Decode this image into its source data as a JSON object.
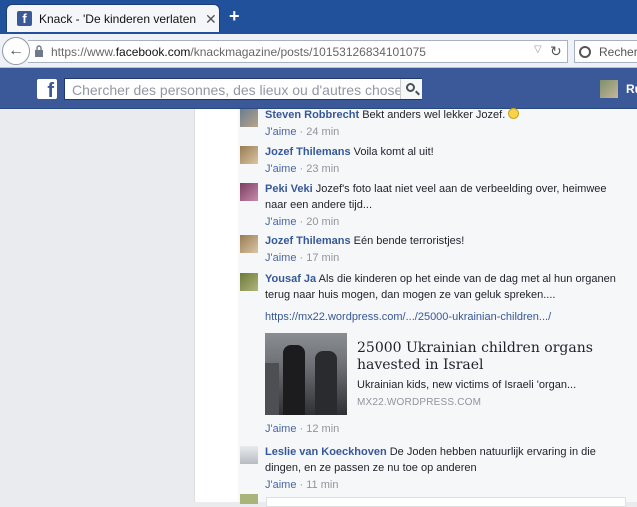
{
  "browser": {
    "tab_title": "Knack - 'De kinderen verlaten ...",
    "url_prefix": "https://www.",
    "url_domain": "facebook.com",
    "url_path": "/knackmagazine/posts/10153126834101075",
    "search_placeholder": "Recherc"
  },
  "facebook": {
    "search_placeholder": "Chercher des personnes, des lieux ou d'autres choses",
    "user_short": "Ru"
  },
  "comments": [
    {
      "author": "Steven Robbrecht",
      "text": "Bekt anders wel lekker Jozef.",
      "like": "J'aime",
      "time": "24 min"
    },
    {
      "author": "Jozef Thilemans",
      "text": "Voila komt al uit!",
      "like": "J'aime",
      "time": "23 min"
    },
    {
      "author": "Peki Veki",
      "text": "Jozef's foto laat niet veel aan de verbeelding over, heimwee naar een andere tijd...",
      "like": "J'aime",
      "time": "20 min"
    },
    {
      "author": "Jozef Thilemans",
      "text": "Eén bende terroristjes!",
      "like": "J'aime",
      "time": "17 min"
    },
    {
      "author": "Yousaf Ja",
      "text": "Als die kinderen op het einde van de dag met al hun organen terug naar huis mogen, dan mogen ze van geluk spreken....",
      "link": "https://mx22.wordpress.com/.../25000-ukrainian-children.../",
      "like": "J'aime",
      "time": "12 min"
    },
    {
      "author": "Leslie van Koeckhoven",
      "text": "De Joden hebben natuurlijk ervaring in die dingen, en ze passen ze nu toe op anderen",
      "like": "J'aime",
      "time": "11 min"
    }
  ],
  "preview": {
    "title": "25000 Ukrainian children organs havested in Israel",
    "description": "Ukrainian kids, new victims of Israeli 'organ...",
    "domain": "MX22.WORDPRESS.COM"
  }
}
